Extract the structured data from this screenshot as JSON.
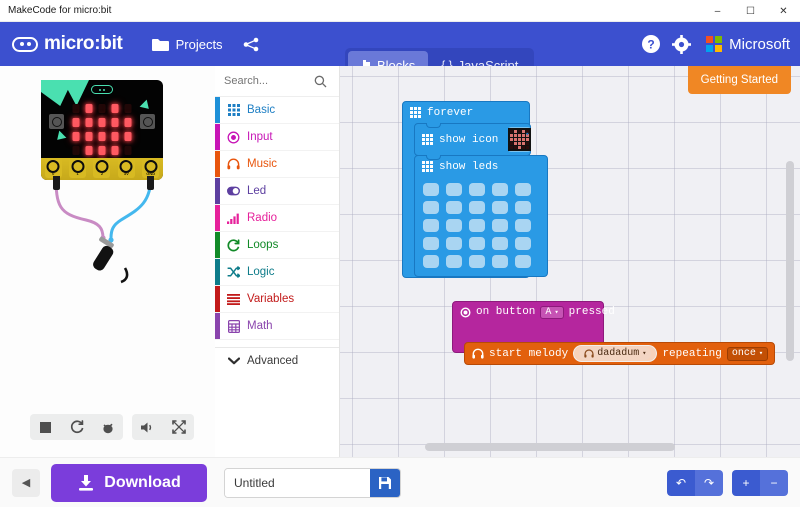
{
  "window": {
    "title": "MakeCode for micro:bit",
    "minimize": "–",
    "maximize": "☐",
    "close": "✕"
  },
  "header": {
    "brand": "micro:bit",
    "projects_label": "Projects",
    "share_icon": "share-icon",
    "help_icon": "help-icon",
    "settings_icon": "gear-icon",
    "microsoft_label": "Microsoft",
    "modes": [
      {
        "label": "Blocks",
        "active": true
      },
      {
        "label": "JavaScript",
        "active": false
      }
    ],
    "colors": {
      "header_bg": "#3c50cf",
      "toggle_bg": "#3346bd",
      "active_mode": "#6a79d8"
    }
  },
  "simulator": {
    "board_label": "micro:bit",
    "pins": [
      "0",
      "1",
      "2",
      "3V",
      "GND"
    ],
    "led_matrix": [
      [
        0,
        1,
        0,
        1,
        0
      ],
      [
        1,
        1,
        1,
        1,
        1
      ],
      [
        1,
        1,
        1,
        1,
        1
      ],
      [
        0,
        1,
        1,
        1,
        0
      ],
      [
        0,
        0,
        1,
        0,
        0
      ]
    ],
    "controls": [
      {
        "name": "stop-button",
        "glyph": "■"
      },
      {
        "name": "restart-button",
        "glyph": "⟳"
      },
      {
        "name": "debug-button",
        "glyph": "🐞"
      },
      {
        "name": "mute-button",
        "glyph": "🔊"
      },
      {
        "name": "fullscreen-button",
        "glyph": "⤡"
      }
    ]
  },
  "toolbox": {
    "search_placeholder": "Search...",
    "categories": [
      {
        "label": "Basic",
        "color": "#1e90d8",
        "text": "#1e7fc4",
        "icon": "grid-icon"
      },
      {
        "label": "Input",
        "color": "#c715b6",
        "text": "#c715b6",
        "icon": "target-icon"
      },
      {
        "label": "Music",
        "color": "#e8550d",
        "text": "#e8550d",
        "icon": "headphones-icon"
      },
      {
        "label": "Led",
        "color": "#5d3fa0",
        "text": "#5d3fa0",
        "icon": "toggle-icon"
      },
      {
        "label": "Radio",
        "color": "#e6219b",
        "text": "#e6219b",
        "icon": "signal-icon"
      },
      {
        "label": "Loops",
        "color": "#128a28",
        "text": "#128a28",
        "icon": "refresh-icon"
      },
      {
        "label": "Logic",
        "color": "#0e7c8a",
        "text": "#0e7c8a",
        "icon": "shuffle-icon"
      },
      {
        "label": "Variables",
        "color": "#c21a1a",
        "text": "#c21a1a",
        "icon": "lines-icon"
      },
      {
        "label": "Math",
        "color": "#8a44ad",
        "text": "#8a44ad",
        "icon": "calculator-icon"
      }
    ],
    "advanced_label": "Advanced"
  },
  "workspace": {
    "getting_started_label": "Getting Started",
    "blocks": {
      "forever": {
        "label": "forever",
        "show_icon": {
          "label": "show icon",
          "icon_matrix": [
            [
              0,
              1,
              0,
              1,
              0
            ],
            [
              1,
              1,
              1,
              1,
              1
            ],
            [
              1,
              1,
              1,
              1,
              1
            ],
            [
              0,
              1,
              1,
              1,
              0
            ],
            [
              0,
              0,
              1,
              0,
              0
            ]
          ],
          "dropdown_caret": "▾"
        },
        "show_leds": {
          "label": "show leds",
          "grid": [
            [
              0,
              0,
              0,
              0,
              0
            ],
            [
              0,
              0,
              0,
              0,
              0
            ],
            [
              0,
              0,
              0,
              0,
              0
            ],
            [
              0,
              0,
              0,
              0,
              0
            ],
            [
              0,
              0,
              0,
              0,
              0
            ]
          ]
        }
      },
      "on_button_pressed": {
        "prefix": "on button",
        "button_value": "A",
        "suffix": "pressed",
        "caret": "▾",
        "start_melody": {
          "prefix": "start melody",
          "melody_value": "dadadum",
          "repeating_label": "repeating",
          "repeat_value": "once",
          "caret": "▾"
        }
      }
    }
  },
  "bottom_bar": {
    "collapse_glyph": "◀",
    "download_label": "Download",
    "project_name": "Untitled",
    "project_placeholder": "Untitled",
    "save_icon": "floppy-icon",
    "undo_glyph": "↶",
    "redo_glyph": "↷",
    "zoom_in_glyph": "+",
    "zoom_out_glyph": "−",
    "download_color": "#7b3ddb",
    "save_color": "#2b63c4"
  }
}
